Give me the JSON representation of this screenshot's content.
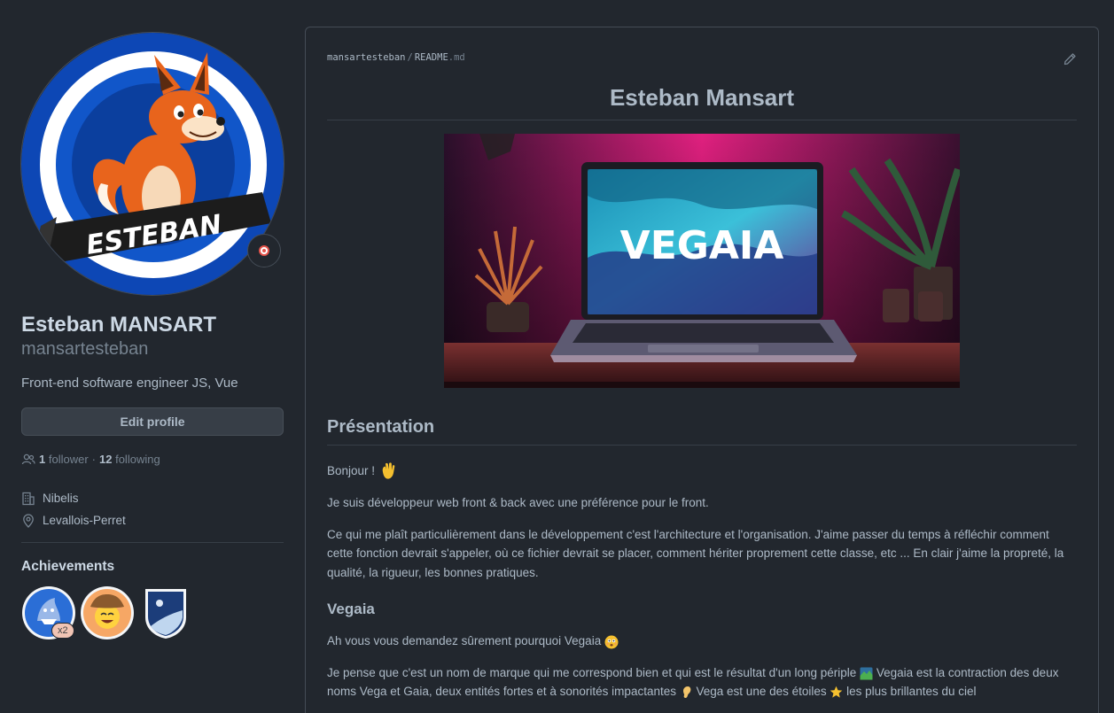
{
  "profile": {
    "avatar_text": "ESTEBAN",
    "fullname": "Esteban MANSART",
    "username": "mansartesteban",
    "bio": "Front-end software engineer JS, Vue",
    "edit_label": "Edit profile",
    "followers_count": "1",
    "followers_label": "follower",
    "dot": "·",
    "following_count": "12",
    "following_label": "following",
    "company": "Nibelis",
    "location": "Levallois-Perret",
    "achievements_title": "Achievements",
    "badge_count": "x2"
  },
  "readme": {
    "owner": "mansartesteban",
    "separator": "/",
    "filename": "README",
    "extension": ".md",
    "title": "Esteban Mansart",
    "hero_text": "VEGAIA",
    "presentation_heading": "Présentation",
    "greeting": "Bonjour !",
    "para1": "Je suis développeur web front & back avec une préférence pour le front.",
    "para2": "Ce qui me plaît particulièrement dans le développement c'est l'architecture et l'organisation. J'aime passer du temps à réfléchir comment cette fonction devrait s'appeler, où ce fichier devrait se placer, comment hériter proprement cette classe, etc ... En clair j'aime la propreté, la qualité, la rigueur, les bonnes pratiques.",
    "vegaia_heading": "Vegaia",
    "para3": "Ah vous vous demandez sûrement pourquoi Vegaia",
    "para4a": "Je pense que c'est un nom de marque qui me correspond bien et qui est le résultat d'un long périple",
    "para4b": "Vegaia est la contraction des deux noms Vega et Gaia, deux entités fortes et à sonorités impactantes",
    "para4c": "Vega est une des étoiles",
    "para4d": "les plus brillantes du ciel"
  },
  "colors": {
    "background": "#22272e",
    "border": "#444c56",
    "text": "#adbac7",
    "muted": "#768390"
  },
  "icons": [
    "target-icon",
    "people-icon",
    "building-icon",
    "location-icon",
    "pencil-icon",
    "wave-emoji-icon",
    "flushed-emoji-icon",
    "map-emoji-icon",
    "ear-emoji-icon",
    "star-emoji-icon"
  ]
}
